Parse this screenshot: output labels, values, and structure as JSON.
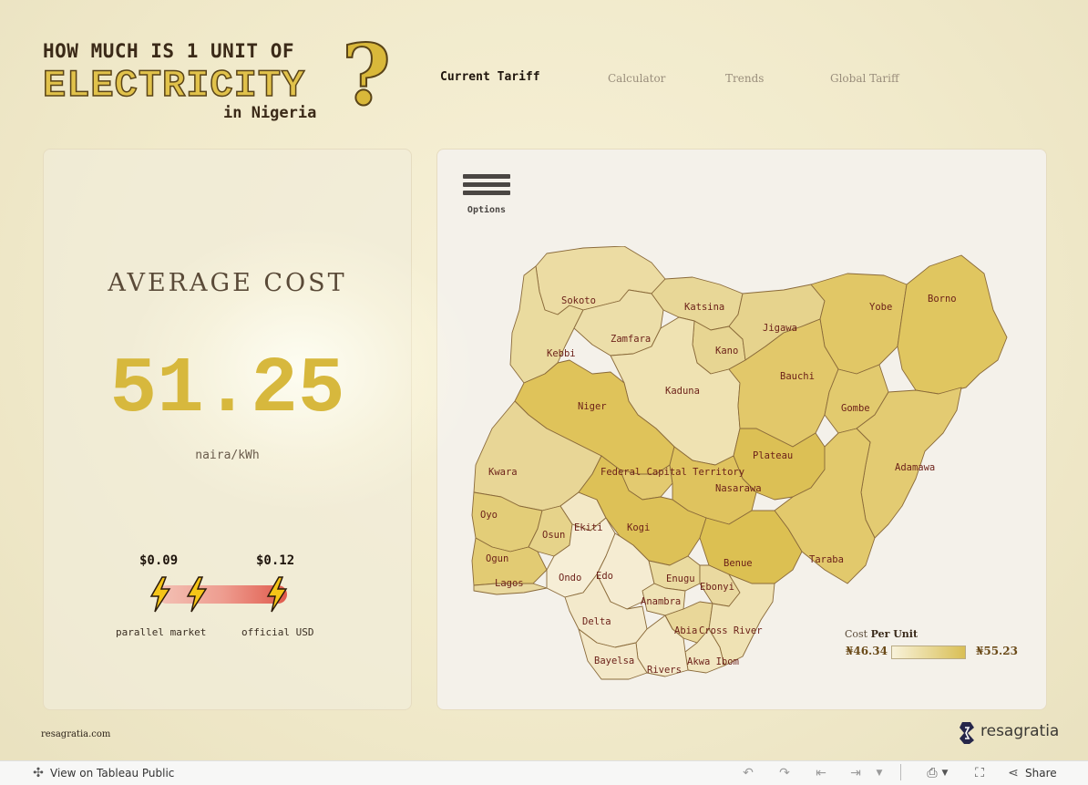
{
  "header": {
    "line1": "HOW MUCH IS 1 UNIT OF",
    "line2": "ELECTRICITY",
    "line3": "in Nigeria",
    "qmark": "?"
  },
  "nav": {
    "tabs": [
      {
        "label": "Current Tariff",
        "active": true
      },
      {
        "label": "Calculator",
        "active": false
      },
      {
        "label": "Trends",
        "active": false
      },
      {
        "label": "Global Tariff",
        "active": false
      }
    ]
  },
  "summary": {
    "label": "AVERAGE COST",
    "value": "51.25",
    "unit": "naira/kWh",
    "parallel_value": "$0.09",
    "official_value": "$0.12",
    "parallel_label": "parallel market",
    "official_label": "official USD"
  },
  "options": {
    "label": "Options"
  },
  "map": {
    "legend_title_prefix": "Cost",
    "legend_title_bold": "Per Unit",
    "min": "₦46.34",
    "max": "₦55.23",
    "low_color": "#f8f2da",
    "high_color": "#d9bf55",
    "states": [
      "Sokoto",
      "Katsina",
      "Yobe",
      "Borno",
      "Zamfara",
      "Jigawa",
      "Kebbi",
      "Kano",
      "Bauchi",
      "Kaduna",
      "Niger",
      "Gombe",
      "Plateau",
      "Kwara",
      "Federal Capital Territory",
      "Adamawa",
      "Nasarawa",
      "Oyo",
      "Ekiti",
      "Kogi",
      "Osun",
      "Ogun",
      "Benue",
      "Taraba",
      "Ondo",
      "Edo",
      "Lagos",
      "Enugu",
      "Ebonyi",
      "Anambra",
      "Delta",
      "Abia",
      "Cross River",
      "Bayelsa",
      "Akwa Ibom",
      "Rivers"
    ]
  },
  "footer": {
    "site": "resagratia.com",
    "brand": "resagratia"
  },
  "toolbar": {
    "view_label": "View on Tableau Public",
    "share_label": "Share"
  }
}
